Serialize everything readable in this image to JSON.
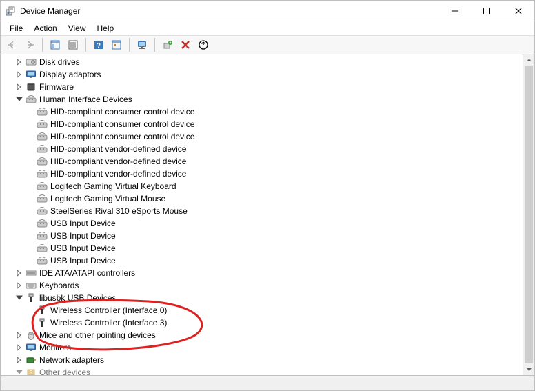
{
  "window": {
    "title": "Device Manager"
  },
  "menubar": {
    "file": "File",
    "action": "Action",
    "view": "View",
    "help": "Help"
  },
  "tree": {
    "disk_drives": "Disk drives",
    "display_adaptors": "Display adaptors",
    "firmware": "Firmware",
    "hid": {
      "label": "Human Interface Devices",
      "items": [
        "HID-compliant consumer control device",
        "HID-compliant consumer control device",
        "HID-compliant consumer control device",
        "HID-compliant vendor-defined device",
        "HID-compliant vendor-defined device",
        "HID-compliant vendor-defined device",
        "Logitech Gaming Virtual Keyboard",
        "Logitech Gaming Virtual Mouse",
        "SteelSeries Rival 310 eSports Mouse",
        "USB Input Device",
        "USB Input Device",
        "USB Input Device",
        "USB Input Device"
      ]
    },
    "ide": "IDE ATA/ATAPI controllers",
    "keyboards": "Keyboards",
    "libusbk": {
      "label": "libusbk USB Devices",
      "items": [
        "Wireless Controller (Interface 0)",
        "Wireless Controller (Interface 3)"
      ]
    },
    "mice": "Mice and other pointing devices",
    "monitors": "Monitors",
    "network": "Network adapters",
    "other": "Other devices"
  }
}
